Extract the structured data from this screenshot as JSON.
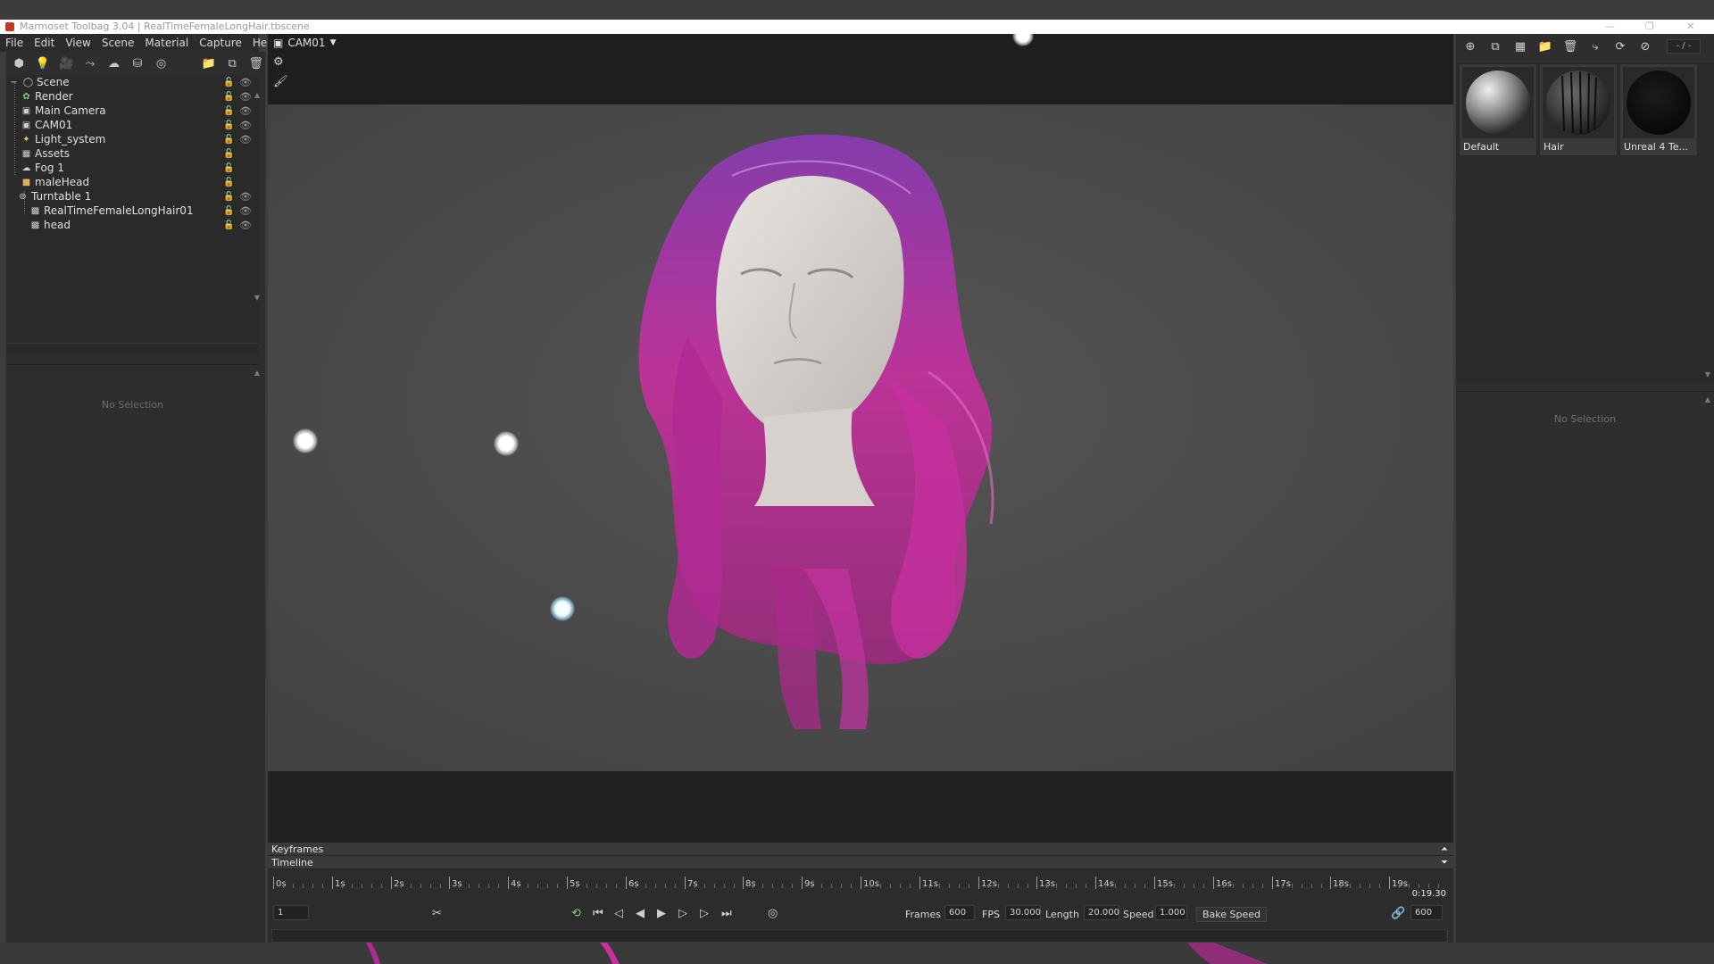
{
  "window": {
    "title": "Marmoset Toolbag 3.04  |  RealTimeFemaleLongHair.tbscene"
  },
  "menu": [
    "File",
    "Edit",
    "View",
    "Scene",
    "Material",
    "Capture",
    "Help"
  ],
  "left_toolbar_icons": [
    "mesh-icon",
    "light-icon",
    "camera-icon",
    "shadow-catcher-icon",
    "fog-icon",
    "turntable-icon",
    "sky-icon",
    "folder-icon",
    "duplicate-icon",
    "delete-icon"
  ],
  "outliner": {
    "items": [
      {
        "label": "Scene",
        "icon": "scene-icon"
      },
      {
        "label": "Render",
        "icon": "render-icon"
      },
      {
        "label": "Main Camera",
        "icon": "camera-icon"
      },
      {
        "label": "CAM01",
        "icon": "camera-icon"
      },
      {
        "label": "Light_system",
        "icon": "light-system-icon"
      },
      {
        "label": "Assets",
        "icon": "assets-icon"
      },
      {
        "label": "Fog 1",
        "icon": "fog-icon"
      },
      {
        "label": "maleHead",
        "icon": "folder-icon"
      },
      {
        "label": "Turntable 1",
        "icon": "turntable-icon"
      },
      {
        "label": "RealTimeFemaleLongHair01",
        "icon": "mesh-icon"
      },
      {
        "label": "head",
        "icon": "mesh-icon"
      }
    ]
  },
  "left_properties": {
    "empty_text": "No Selection"
  },
  "viewport": {
    "camera": "CAM01",
    "settings_icon": "gear-icon",
    "brush_icon": "paint-brush-icon"
  },
  "timeline": {
    "keyframes_label": "Keyframes",
    "timeline_label": "Timeline",
    "ticks": [
      "0s",
      "1s",
      "2s",
      "3s",
      "4s",
      "5s",
      "6s",
      "7s",
      "8s",
      "9s",
      "10s",
      "11s",
      "12s",
      "13s",
      "14s",
      "15s",
      "16s",
      "17s",
      "18s",
      "19s"
    ],
    "current_time": "0:19.30",
    "current_frame": "1",
    "frames_label": "Frames",
    "frames_value": "600",
    "fps_label": "FPS",
    "fps_value": "30.000",
    "length_label": "Length",
    "length_value": "20.000",
    "speed_label": "Speed",
    "speed_value": "1.000",
    "bake_speed_label": "Bake Speed",
    "end_frame": "600"
  },
  "right_toolbar_icons": [
    "add-material-icon",
    "duplicate-material-icon",
    "checker-icon",
    "folder-icon",
    "delete-icon",
    "pick-material-icon",
    "refresh-icon",
    "settings-icon"
  ],
  "right_field": "- / -",
  "materials": [
    {
      "label": "Default"
    },
    {
      "label": "Hair"
    },
    {
      "label": "Unreal 4 Te..."
    }
  ],
  "right_properties": {
    "empty_text": "No Selection"
  },
  "colors": {
    "hair_magenta": "#c7309f",
    "hair_purple": "#8a3bb5",
    "viewport_bg": "#4a4a4a"
  }
}
